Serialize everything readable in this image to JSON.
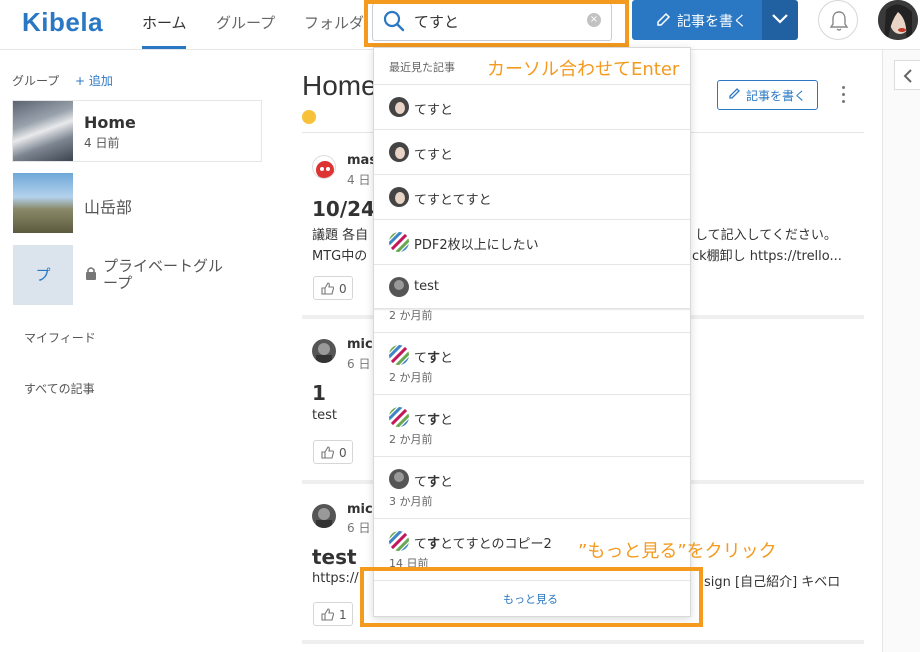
{
  "colors": {
    "accent": "#2a78c4",
    "annotation": "#f39a1f"
  },
  "header": {
    "logo": "Kibela",
    "nav": [
      "ホーム",
      "グループ",
      "フォルダ"
    ],
    "search": {
      "value": "てすと",
      "icon": "search-icon",
      "clear_icon": "clear-icon"
    },
    "write_label": "記事を書く"
  },
  "sidebar": {
    "groups_label": "グループ",
    "add_label": "+ 追加",
    "groups": [
      {
        "title": "Home",
        "time": "4 日前"
      },
      {
        "title": "山岳部"
      },
      {
        "title": "プライベートグループ",
        "thumb": "プ"
      }
    ],
    "myfeed": "マイフィード",
    "all": "すべての記事"
  },
  "main": {
    "title": "Home",
    "write_label": "記事を書く",
    "posts": [
      {
        "author": "mas",
        "time": "4 日",
        "title": "10/24",
        "body1": "議題 各自",
        "body1_right": "して記入してください。",
        "body2": "MTG中の",
        "body2_right": "ck棚卸し https://trello...",
        "likes": "0"
      },
      {
        "author": "mic",
        "time": "6 日",
        "title": "1",
        "body1": "test",
        "likes": "0"
      },
      {
        "author": "mic",
        "time": "6 日",
        "title": "test",
        "body1": "https://",
        "body1_right": "sign [自己紹介] キベロ",
        "likes": "1"
      }
    ]
  },
  "dropdown": {
    "recent_label": "最近見た記事",
    "recent": [
      {
        "title": "てすと"
      },
      {
        "title": "てすと"
      },
      {
        "title": "てすとてすと"
      },
      {
        "title": "PDF2枚以上にしたい"
      },
      {
        "title": "test"
      }
    ],
    "results": [
      {
        "pre": "て",
        "bold": "す",
        "post": "と",
        "time": "2 か月前"
      },
      {
        "pre": "て",
        "bold": "す",
        "post": "と",
        "time": "2 か月前"
      },
      {
        "pre": "て",
        "bold": "す",
        "post": "と",
        "time": "3 か月前"
      },
      {
        "pre": "て",
        "bold": "す",
        "post": "とてすとのコピー2",
        "time": "14 日前"
      }
    ],
    "partial_time": "2 か月前",
    "more_label": "もっと見る"
  },
  "annotations": {
    "enter": "カーソル合わせてEnter",
    "more": "”もっと見る”をクリック"
  }
}
